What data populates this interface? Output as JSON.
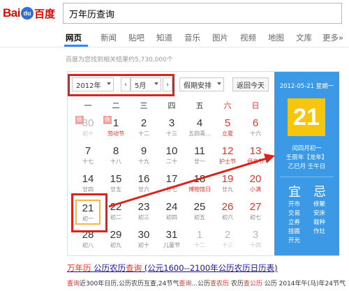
{
  "header": {
    "logo": {
      "text_left": "Bai",
      "paw": "du",
      "text_right": "百度"
    },
    "search_value": "万年历查询"
  },
  "nav": {
    "items": [
      "网页",
      "新闻",
      "贴吧",
      "知道",
      "音乐",
      "图片",
      "视频",
      "地图",
      "文库",
      "更多»"
    ],
    "active": "网页"
  },
  "result_count": "百度为您找到相关结果约5,730,000个",
  "calendar": {
    "year_select": "2012年",
    "month_select": "5月",
    "month_prev": "‹",
    "month_next": "›",
    "holiday_select": "假期安排",
    "today_button": "返回今天",
    "weekdays": [
      "一",
      "二",
      "三",
      "四",
      "五",
      "六",
      "日"
    ],
    "weeks": [
      [
        {
          "day": "30",
          "sub": "初十",
          "other": true,
          "badge": "休"
        },
        {
          "day": "1",
          "sub": "劳动节",
          "festival": true,
          "badge": "休"
        },
        {
          "day": "2",
          "sub": "十二"
        },
        {
          "day": "3",
          "sub": "十三"
        },
        {
          "day": "4",
          "sub": "五四青..."
        },
        {
          "day": "5",
          "sub": "立夏",
          "weekend": true,
          "festival": true
        },
        {
          "day": "6",
          "sub": "十六",
          "weekend": true
        }
      ],
      [
        {
          "day": "7",
          "sub": "十七"
        },
        {
          "day": "8",
          "sub": "十八"
        },
        {
          "day": "9",
          "sub": "十九"
        },
        {
          "day": "10",
          "sub": "二十"
        },
        {
          "day": "11",
          "sub": "廿一"
        },
        {
          "day": "12",
          "sub": "护士节",
          "weekend": true,
          "festival": true
        },
        {
          "day": "13",
          "sub": "母亲节",
          "weekend": true,
          "festival": true
        }
      ],
      [
        {
          "day": "14",
          "sub": "廿四"
        },
        {
          "day": "15",
          "sub": "廿五"
        },
        {
          "day": "16",
          "sub": "廿六"
        },
        {
          "day": "17",
          "sub": "廿七"
        },
        {
          "day": "18",
          "sub": "博物馆日",
          "festival": true
        },
        {
          "day": "19",
          "sub": "廿九",
          "weekend": true
        },
        {
          "day": "20",
          "sub": "小满",
          "weekend": true,
          "festival": true
        }
      ],
      [
        {
          "day": "21",
          "sub": "初一",
          "today": true
        },
        {
          "day": "22",
          "sub": "初二"
        },
        {
          "day": "23",
          "sub": "初三"
        },
        {
          "day": "24",
          "sub": "初四"
        },
        {
          "day": "25",
          "sub": "初五"
        },
        {
          "day": "26",
          "sub": "初六",
          "weekend": true
        },
        {
          "day": "27",
          "sub": "初七",
          "weekend": true
        }
      ],
      [
        {
          "day": "28",
          "sub": "初八"
        },
        {
          "day": "29",
          "sub": "初九"
        },
        {
          "day": "30",
          "sub": "初十"
        },
        {
          "day": "31",
          "sub": "儿童节"
        },
        {
          "day": "1",
          "sub": "十二",
          "other": true
        },
        {
          "day": "2",
          "sub": "十三",
          "other": true,
          "weekend": true
        },
        {
          "day": "3",
          "sub": "十四",
          "other": true,
          "weekend": true
        }
      ]
    ]
  },
  "side_panel": {
    "date_line": "2012-05-21 星期一",
    "big_day": "21",
    "lunar_date": "闰四月初一",
    "year_ganzhi": "壬辰年【龙年】",
    "month_day_ganzhi": "乙巳月 壬午日",
    "yi_label": "宜",
    "ji_label": "忌",
    "yi_items": [
      "开市",
      "交易",
      "立券",
      "挂匾",
      "开光"
    ],
    "ji_items": [
      "修聚",
      "安床",
      "栽种",
      "作灶"
    ]
  },
  "result": {
    "title_parts": [
      "万年历",
      " 公历农历",
      "查询",
      " (公元1600--2100年公历农历日历表)"
    ],
    "desc_parts": [
      "查询",
      "近300年日历,公历农历互查,24节气",
      "查询",
      "...公历",
      "查农历",
      " 农历",
      "查公历",
      " 公历 2014年午(马)年24节气"
    ]
  },
  "colors": {
    "highlight_red": "#d9241b",
    "side_blue": "#3b99e6",
    "today_yellow": "#f6c60f",
    "link": "#1a0dab"
  }
}
